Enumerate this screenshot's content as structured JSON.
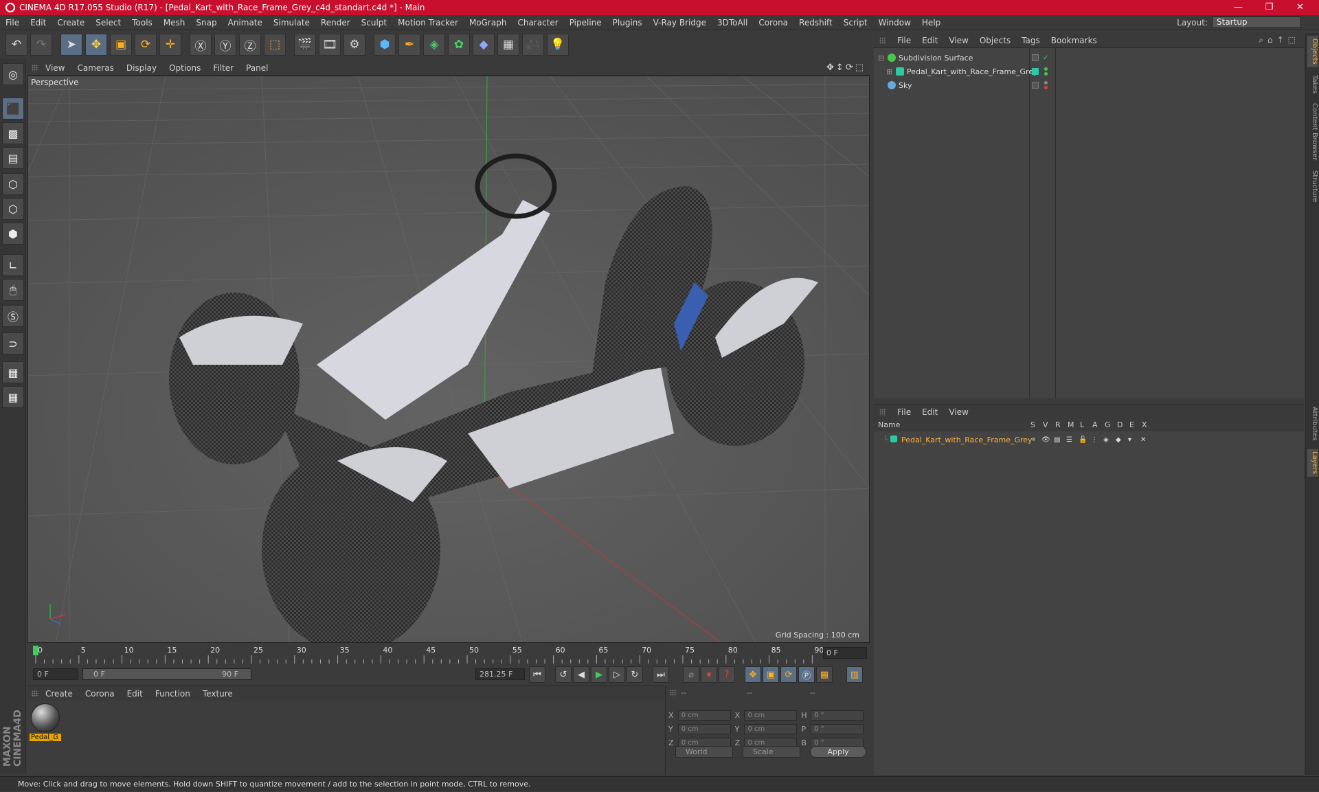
{
  "window": {
    "title": "CINEMA 4D R17.055 Studio (R17) - [Pedal_Kart_with_Race_Frame_Grey_c4d_standart.c4d *] - Main"
  },
  "menubar": {
    "items": [
      "File",
      "Edit",
      "Create",
      "Select",
      "Tools",
      "Mesh",
      "Snap",
      "Animate",
      "Simulate",
      "Render",
      "Sculpt",
      "Motion Tracker",
      "MoGraph",
      "Character",
      "Pipeline",
      "Plugins",
      "V-Ray Bridge",
      "3DToAll",
      "Corona",
      "Redshift",
      "Script",
      "Window",
      "Help"
    ],
    "layout_label": "Layout:",
    "layout_value": "Startup"
  },
  "viewport": {
    "menu": [
      "View",
      "Cameras",
      "Display",
      "Options",
      "Filter",
      "Panel"
    ],
    "label": "Perspective",
    "grid_spacing": "Grid Spacing : 100 cm"
  },
  "timeline": {
    "ticks": [
      "0",
      "5",
      "10",
      "15",
      "20",
      "25",
      "30",
      "35",
      "40",
      "45",
      "50",
      "55",
      "60",
      "65",
      "70",
      "75",
      "80",
      "85",
      "90"
    ],
    "current_frame": "0 F",
    "start_field": "0 F",
    "range_start": "0 F",
    "range_end": "90 F",
    "end_field": "281.25 F"
  },
  "material_manager": {
    "menu": [
      "Create",
      "Corona",
      "Edit",
      "Function",
      "Texture"
    ],
    "material_name": "Pedal_G"
  },
  "coordinates": {
    "headers": [
      "--",
      "--",
      "--"
    ],
    "rows": [
      {
        "l1": "X",
        "v1": "0 cm",
        "l2": "X",
        "v2": "0 cm",
        "l3": "H",
        "v3": "0 °"
      },
      {
        "l1": "Y",
        "v1": "0 cm",
        "l2": "Y",
        "v2": "0 cm",
        "l3": "P",
        "v3": "0 °"
      },
      {
        "l1": "Z",
        "v1": "0 cm",
        "l2": "Z",
        "v2": "0 cm",
        "l3": "B",
        "v3": "0 °"
      }
    ],
    "mode_world": "World",
    "mode_scale": "Scale",
    "apply_label": "Apply"
  },
  "status": {
    "text": "Move: Click and drag to move elements. Hold down SHIFT to quantize movement / add to the selection in point mode, CTRL to remove."
  },
  "object_manager": {
    "menu": [
      "File",
      "Edit",
      "View",
      "Objects",
      "Tags",
      "Bookmarks"
    ],
    "objects": [
      {
        "name": "Subdivision Surface",
        "icon_color": "#46c94a"
      },
      {
        "name": "Pedal_Kart_with_Race_Frame_Grey",
        "icon_color": "#2ec9a4"
      },
      {
        "name": "Sky",
        "icon_color": "#6aa8e0"
      }
    ]
  },
  "layer_manager": {
    "menu": [
      "File",
      "Edit",
      "View"
    ],
    "columns": [
      "Name",
      "S",
      "V",
      "R",
      "M",
      "L",
      "A",
      "G",
      "D",
      "E",
      "X"
    ],
    "layers": [
      {
        "name": "Pedal_Kart_with_Race_Frame_Grey",
        "color": "#2ec9a4"
      }
    ]
  },
  "right_tabs": [
    "Objects",
    "Takes",
    "Content Browser",
    "Structure",
    "Attributes",
    "Layers"
  ],
  "colors": {
    "title_bar": "#c8102e",
    "accent": "#e8a400",
    "selected_layer_text": "#ffb13b"
  }
}
